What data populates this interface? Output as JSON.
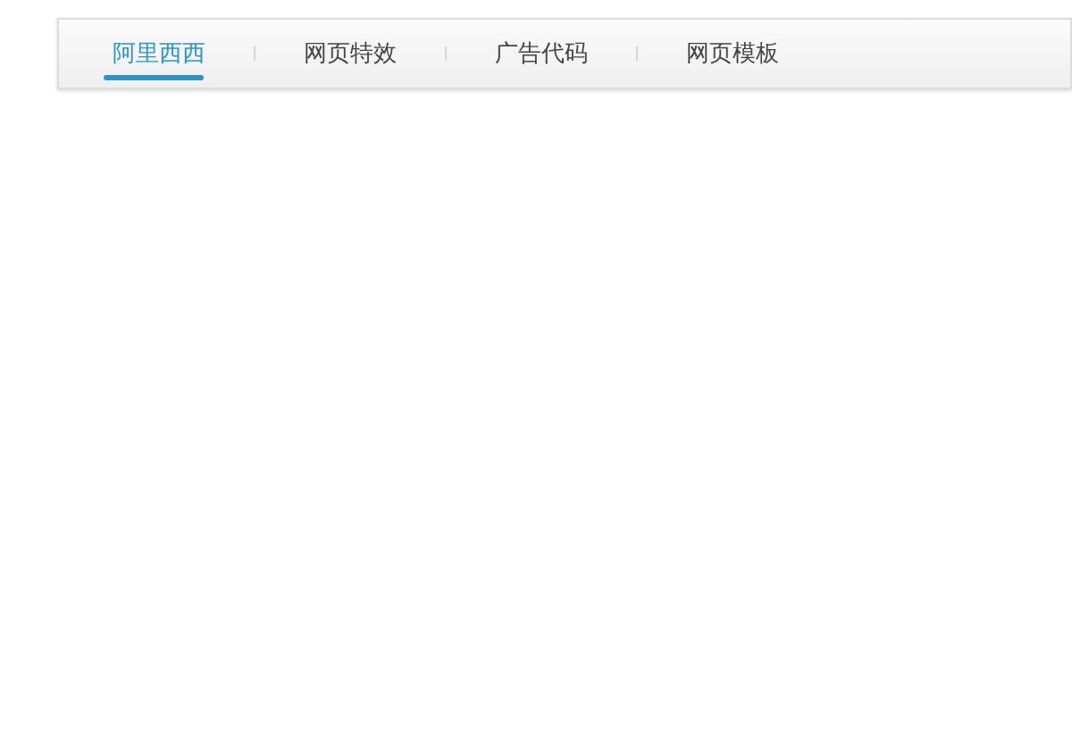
{
  "tabs": [
    {
      "label": "阿里西西",
      "selected": true
    },
    {
      "label": "网页特效",
      "selected": false
    },
    {
      "label": "广告代码",
      "selected": false
    },
    {
      "label": "网页模板",
      "selected": false
    }
  ]
}
